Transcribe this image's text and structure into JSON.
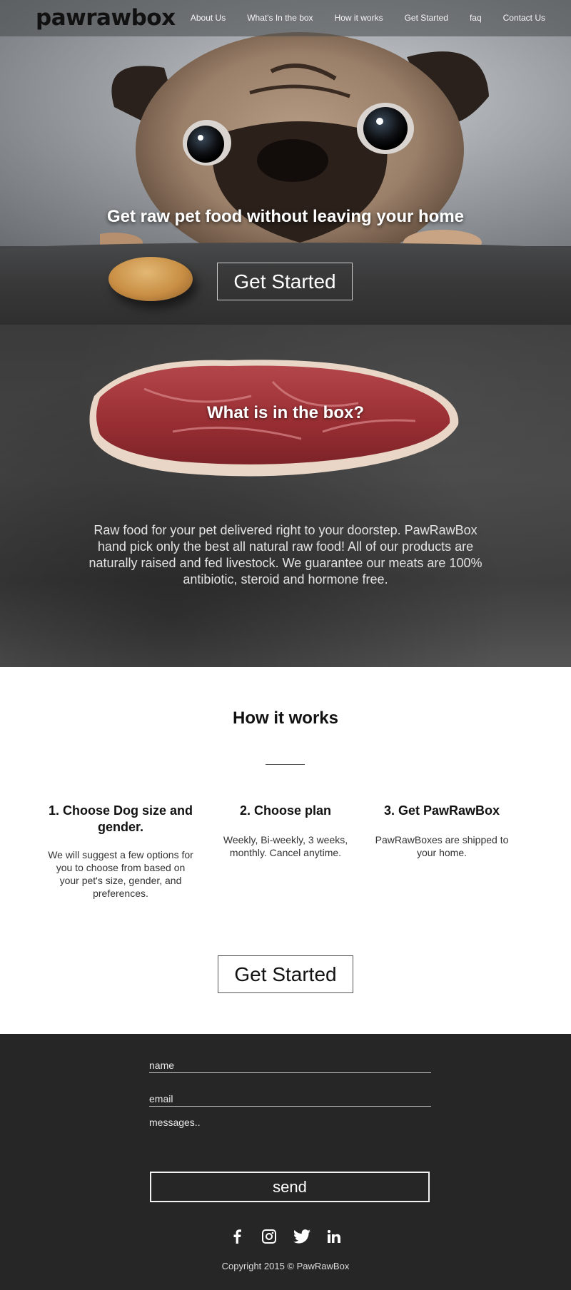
{
  "header": {
    "logo": "pawrawbox",
    "nav": [
      "About Us",
      "What's In the box",
      "How it works",
      "Get Started",
      "faq",
      "Contact Us"
    ]
  },
  "hero": {
    "title": "Get raw pet food without leaving your home",
    "cta": "Get Started"
  },
  "box": {
    "title": "What is in the box?",
    "text": "Raw food for your pet delivered right to your doorstep. PawRawBox hand pick only the best all natural raw food! All of our products are naturally raised and fed livestock. We guarantee our meats are 100% antibiotic, steroid and hormone free."
  },
  "how": {
    "title": "How it works",
    "steps": [
      {
        "title": "1. Choose Dog size and gender.",
        "text": "We will suggest a few options for you to choose from based on your pet's size, gender, and preferences."
      },
      {
        "title": "2. Choose plan",
        "text": "Weekly, Bi-weekly, 3 weeks, monthly. Cancel anytime."
      },
      {
        "title": "3. Get PawRawBox",
        "text": "PawRawBoxes are shipped to your home."
      }
    ],
    "cta": "Get Started"
  },
  "contact": {
    "name_placeholder": "name",
    "email_placeholder": "email",
    "message_placeholder": "messages..",
    "send_label": "send"
  },
  "footer": {
    "socials": [
      "facebook-icon",
      "instagram-icon",
      "twitter-icon",
      "linkedin-icon"
    ],
    "copyright": "Copyright 2015 © PawRawBox"
  },
  "colors": {
    "footer_bg": "#262626",
    "accent": "#ffffff"
  }
}
